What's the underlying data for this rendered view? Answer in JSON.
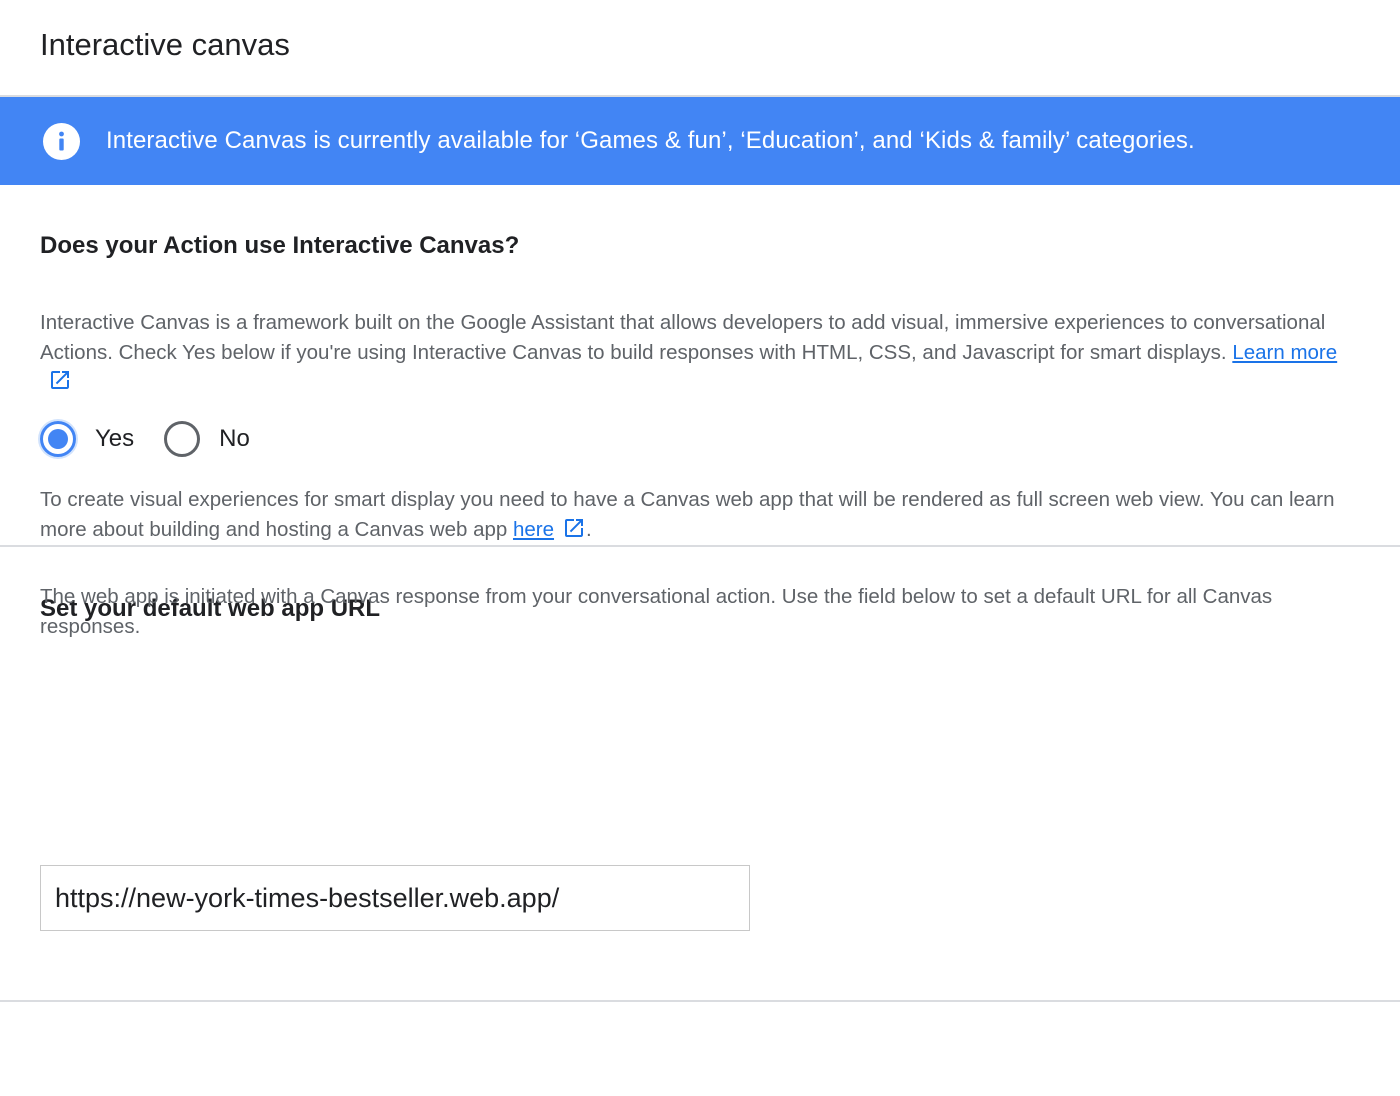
{
  "header": {
    "title": "Interactive canvas"
  },
  "banner": {
    "icon": "info-icon",
    "text": "Interactive Canvas is currently available for ‘Games & fun’, ‘Education’, and ‘Kids & family’ categories.",
    "background_color": "#4285f4"
  },
  "interactive_canvas_section": {
    "heading": "Does your Action use Interactive Canvas?",
    "description": "Interactive Canvas is a framework built on the Google Assistant that allows developers to add visual, immersive experiences to conversational Actions. Check Yes below if you're using Interactive Canvas to build responses with HTML, CSS, and Javascript for smart displays.",
    "learn_more_label": "Learn more",
    "options": [
      {
        "label": "Yes",
        "selected": true
      },
      {
        "label": "No",
        "selected": false
      }
    ]
  },
  "web_app_section": {
    "heading": "Set your default web app URL",
    "description_1_prefix": "To create visual experiences for smart display you need to have a Canvas web app that will be rendered as full screen web view. You can learn more about building and hosting a Canvas web app",
    "here_label": "here",
    "description_1_suffix": ".",
    "description_2": "The web app is initiated with a Canvas response from your conversational action. Use the field below to set a default URL for all Canvas responses.",
    "url_value": "https://new-york-times-bestseller.web.app/"
  },
  "colors": {
    "accent": "#4285f4",
    "link": "#1a73e8"
  }
}
